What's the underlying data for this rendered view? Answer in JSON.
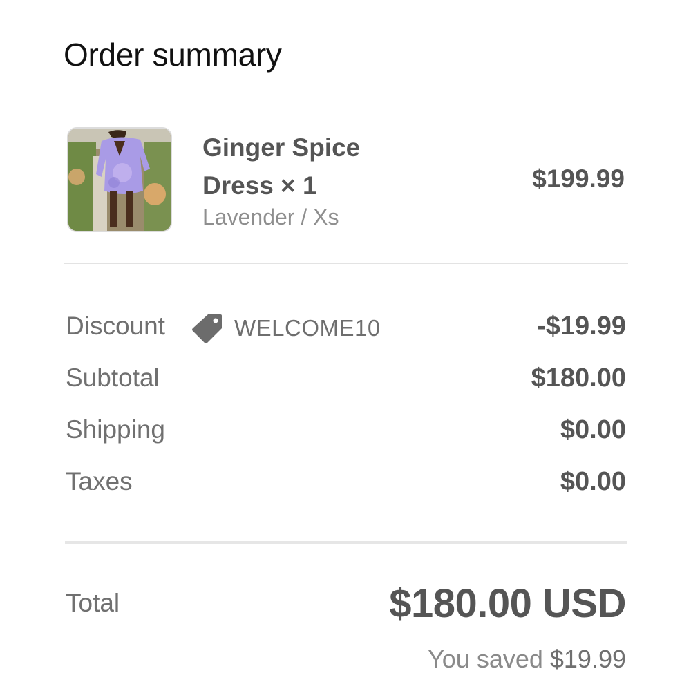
{
  "header": {
    "title": "Order summary"
  },
  "line_item": {
    "name_line1": "Ginger Spice",
    "name_line2": "Dress × 1",
    "variant": "Lavender / Xs",
    "price": "$199.99",
    "image": "product-photo-dress"
  },
  "summary": {
    "discount_label": "Discount",
    "discount_code": "WELCOME10",
    "discount_icon": "tag-icon",
    "discount_value": "-$19.99",
    "subtotal_label": "Subtotal",
    "subtotal_value": "$180.00",
    "shipping_label": "Shipping",
    "shipping_value": "$0.00",
    "taxes_label": "Taxes",
    "taxes_value": "$0.00"
  },
  "total": {
    "label": "Total",
    "value": "$180.00 USD",
    "saved_prefix": "You saved",
    "saved_amount": "$19.99"
  },
  "colors": {
    "title_text": "#111111",
    "value_text": "#555555",
    "label_text": "#707070",
    "muted_text": "#8e8e8e",
    "divider": "#e3e3e3",
    "product_color": "#a99be6"
  }
}
